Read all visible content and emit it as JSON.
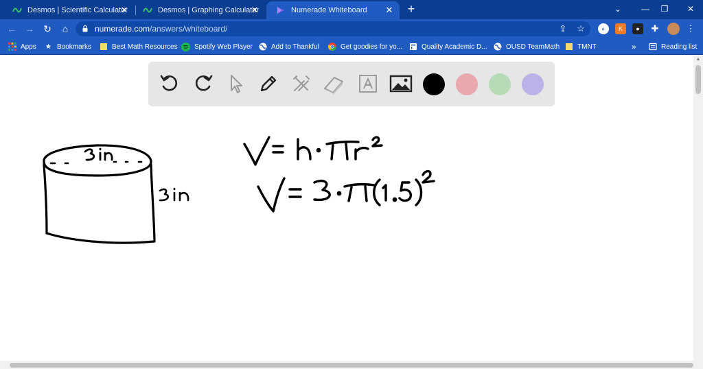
{
  "tabs": [
    {
      "title": "Desmos | Scientific Calculator",
      "icon": "desmos-icon"
    },
    {
      "title": "Desmos | Graphing Calculator",
      "icon": "desmos-icon"
    },
    {
      "title": "Numerade Whiteboard",
      "icon": "numerade-icon",
      "active": true
    }
  ],
  "address": {
    "domain": "numerade.com",
    "path": "/answers/whiteboard/"
  },
  "bookmarks": [
    {
      "label": "Apps",
      "icon": "apps-grid-icon"
    },
    {
      "label": "Bookmarks",
      "icon": "star-icon"
    },
    {
      "label": "Best Math Resources",
      "icon": "folder-icon"
    },
    {
      "label": "Spotify Web Player",
      "icon": "spotify-icon"
    },
    {
      "label": "Add to Thankful",
      "icon": "globe-icon"
    },
    {
      "label": "Get goodies for yo...",
      "icon": "chrome-icon"
    },
    {
      "label": "Quality Academic D...",
      "icon": "document-icon"
    },
    {
      "label": "OUSD TeamMath",
      "icon": "globe-icon"
    },
    {
      "label": "TMNT",
      "icon": "folder-icon"
    }
  ],
  "reading_list": "Reading list",
  "whiteboard": {
    "tools": [
      "undo-icon",
      "redo-icon",
      "pointer-icon",
      "pen-icon",
      "tools-icon",
      "eraser-icon",
      "text-icon",
      "image-icon"
    ],
    "colors": [
      "#000000",
      "#e8a8ad",
      "#b7dbb6",
      "#b9b3e8"
    ]
  },
  "handwriting": {
    "top_label": "3in",
    "side_label": "3in",
    "formula_1": "V = h·πr²",
    "formula_2": "V = 3·π(1.5)²"
  },
  "theme": {
    "tab_bar": "#0b3d91",
    "toolbar": "#1f5bc1"
  }
}
